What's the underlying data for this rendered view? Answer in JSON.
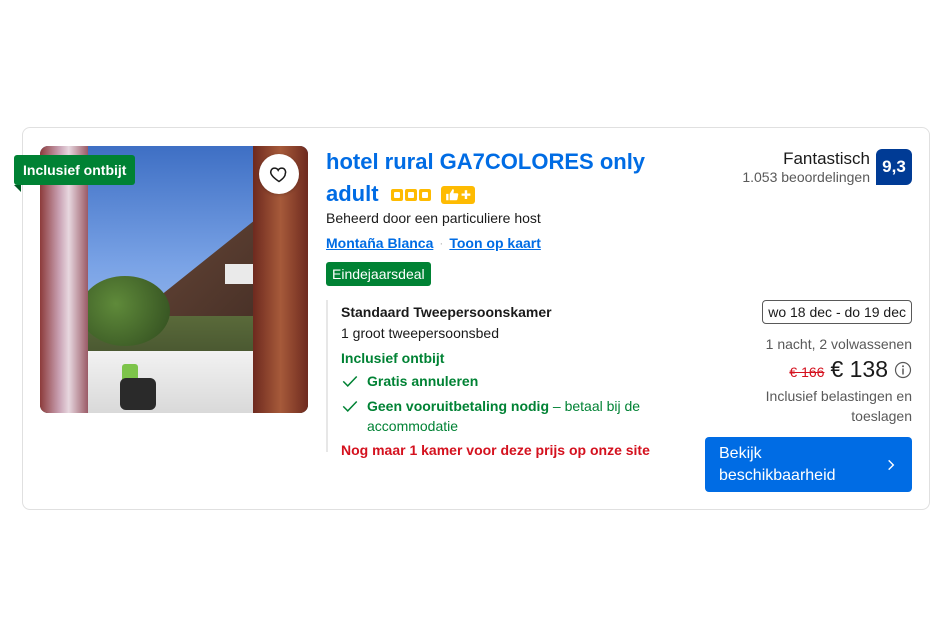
{
  "badge_breakfast": "Inclusief ontbijt",
  "hotel": {
    "name": "hotel rural GA7COLORES only adult",
    "stars": 3,
    "host": "Beheerd door een particuliere host",
    "location_link": "Montaña Blanca",
    "map_link": "Toon op kaart",
    "deal_badge": "Eindejaarsdeal"
  },
  "room": {
    "name": "Standaard Tweepersoonskamer",
    "bed": "1 groot tweepersoonsbed",
    "breakfast": "Inclusief ontbijt",
    "perk1": "Gratis annuleren",
    "perk2_bold": "Geen vooruitbetaling nodig",
    "perk2_rest": " – betaal bij de accommodatie",
    "scarcity": "Nog maar 1 kamer voor deze prijs op onze site"
  },
  "review": {
    "word": "Fantastisch",
    "count": "1.053 beoordelingen",
    "score": "9,3"
  },
  "pricing": {
    "dates": "wo 18 dec - do 19 dec",
    "stay": "1 nacht, 2 volwassenen",
    "old_price": "€ 166",
    "new_price": "€ 138",
    "taxes": "Inclusief belastingen en toeslagen"
  },
  "cta": {
    "label": "Bekijk beschikbaarheid"
  },
  "colors": {
    "link_blue": "#006ce4",
    "green": "#008234",
    "score_blue": "#003b95",
    "red": "#d4111e",
    "star_yellow": "#febb02"
  },
  "icons": [
    "heart-icon",
    "star-icon",
    "thumbs-up-icon",
    "plus-icon",
    "check-icon",
    "info-icon",
    "chevron-right-icon"
  ]
}
